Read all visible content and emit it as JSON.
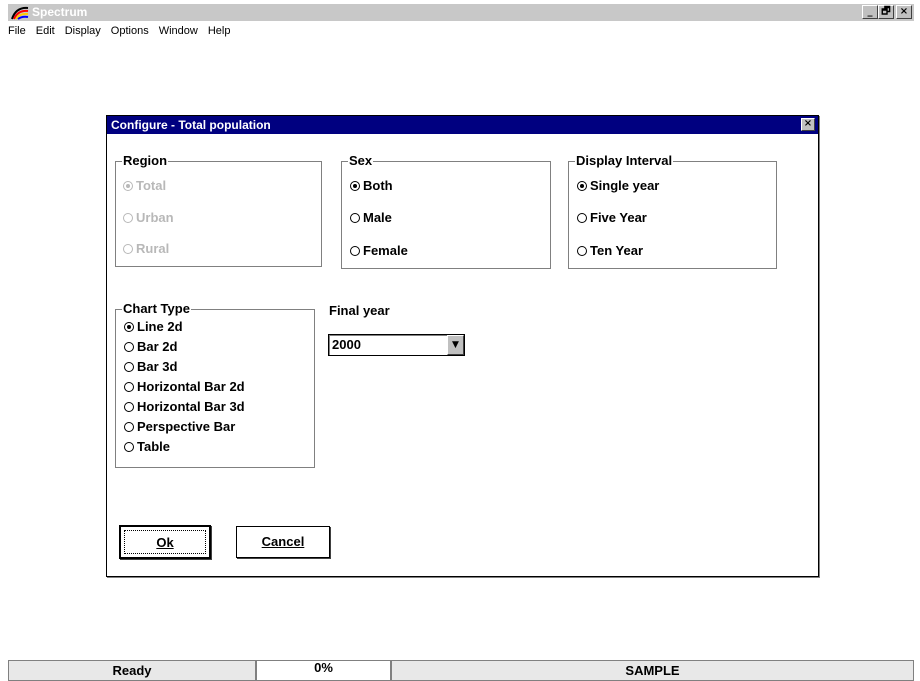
{
  "window": {
    "title": "Spectrum",
    "minimize_label": "_",
    "restore_label": "🗗",
    "close_label": "×"
  },
  "menu": {
    "items": [
      {
        "label": "File"
      },
      {
        "label": "Edit"
      },
      {
        "label": "Display"
      },
      {
        "label": "Options"
      },
      {
        "label": "Window"
      },
      {
        "label": "Help"
      }
    ]
  },
  "dialog": {
    "title": "Configure - Total population",
    "close_label": "×",
    "region": {
      "legend": "Region",
      "options": [
        {
          "label": "Total",
          "selected": true,
          "enabled": false
        },
        {
          "label": "Urban",
          "selected": false,
          "enabled": false
        },
        {
          "label": "Rural",
          "selected": false,
          "enabled": false
        }
      ]
    },
    "sex": {
      "legend": "Sex",
      "options": [
        {
          "label": "Both",
          "selected": true
        },
        {
          "label": "Male",
          "selected": false
        },
        {
          "label": "Female",
          "selected": false
        }
      ]
    },
    "display_interval": {
      "legend": "Display Interval",
      "options": [
        {
          "label": "Single year",
          "selected": true
        },
        {
          "label": "Five Year",
          "selected": false
        },
        {
          "label": "Ten Year",
          "selected": false
        }
      ]
    },
    "chart_type": {
      "legend": "Chart Type",
      "options": [
        {
          "label": "Line 2d",
          "selected": true
        },
        {
          "label": "Bar 2d",
          "selected": false
        },
        {
          "label": "Bar 3d",
          "selected": false
        },
        {
          "label": "Horizontal Bar 2d",
          "selected": false
        },
        {
          "label": "Horizontal Bar 3d",
          "selected": false
        },
        {
          "label": "Perspective Bar",
          "selected": false
        },
        {
          "label": "Table",
          "selected": false
        }
      ]
    },
    "final_year": {
      "label": "Final year",
      "value": "2000",
      "arrow": "▼"
    },
    "ok_label": "Ok",
    "cancel_label": "Cancel"
  },
  "status": {
    "message": "Ready",
    "progress": "0%",
    "mode": "SAMPLE"
  }
}
